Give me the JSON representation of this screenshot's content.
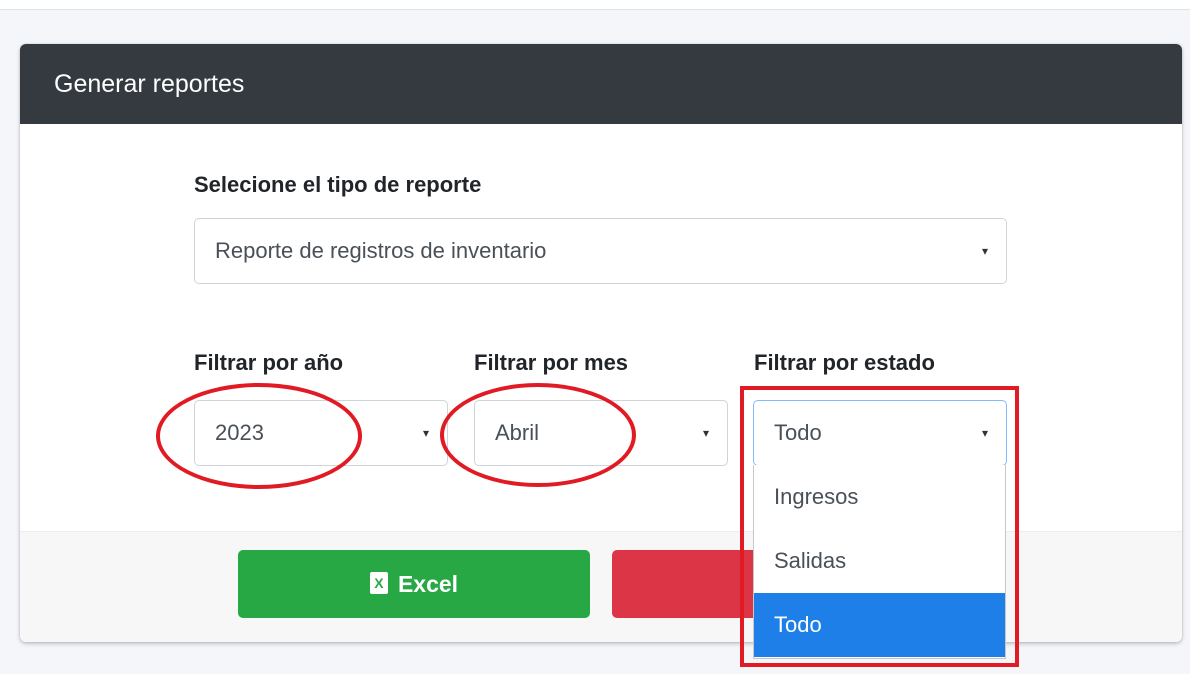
{
  "card": {
    "title": "Generar reportes"
  },
  "report_type": {
    "label": "Selecione el tipo de reporte",
    "value": "Reporte de registros de inventario"
  },
  "filters": {
    "year": {
      "label": "Filtrar por año",
      "value": "2023"
    },
    "month": {
      "label": "Filtrar por mes",
      "value": "Abril"
    },
    "status": {
      "label": "Filtrar por estado",
      "value": "Todo",
      "options": [
        "Ingresos",
        "Salidas",
        "Todo"
      ],
      "selected": "Todo"
    }
  },
  "buttons": {
    "excel": "Excel",
    "pdf": ""
  },
  "icons": {
    "caret": "▾",
    "excel_icon": "X"
  },
  "colors": {
    "header_bg": "#343a40",
    "excel_green": "#28a745",
    "pdf_red": "#dc3545",
    "dropdown_active": "#1e7fe8",
    "annotation_red": "#e01b24"
  }
}
